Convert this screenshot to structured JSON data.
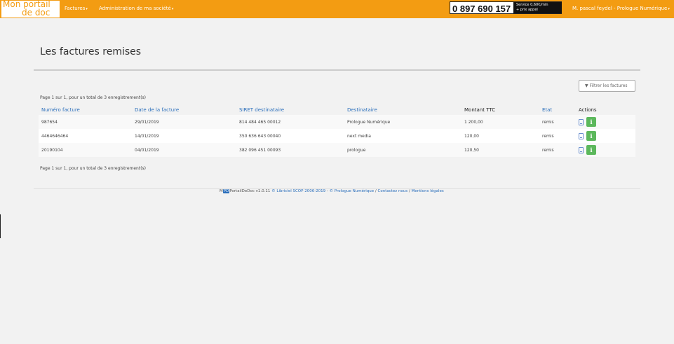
{
  "nav": {
    "logo_line1": "Mon portail",
    "logo_line2": "de doc",
    "menu_factures": "Factures",
    "menu_admin": "Administration de ma société",
    "phone_number": "0 897 690 157",
    "phone_service_line1": "Service 0,60€/min",
    "phone_service_line2": "+ prix appel",
    "user": "M. pascal feydel - Prologue Numérique",
    "caret": "▾"
  },
  "page": {
    "title": "Les factures remises",
    "filter_label": "Filtrer les factures",
    "filter_icon": "filter-icon",
    "page_info_top": "Page 1 sur 1, pour un total de 3 enregistrement(s)",
    "page_info_bottom": "Page 1 sur 1, pour un total de 3 enregistrement(s)"
  },
  "table": {
    "headers": [
      "Numéro facture",
      "Date de la facture",
      "SIRET destinataire",
      "Destinataire",
      "Montant TTC",
      "Etat",
      "Actions"
    ],
    "rows": [
      {
        "numero": "987654",
        "date": "29/01/2019",
        "siret": "814 484 465 00012",
        "destinataire": "Prologue Numérique",
        "montant": "1 200,00",
        "etat": "remis"
      },
      {
        "numero": "4464646464",
        "date": "14/01/2019",
        "siret": "350 636 643 00040",
        "destinataire": "next media",
        "montant": "120,00",
        "etat": "remis"
      },
      {
        "numero": "20190104",
        "date": "04/01/2019",
        "siret": "382 096 451 00093",
        "destinataire": "prologue",
        "montant": "120,50",
        "etat": "remis"
      }
    ],
    "info_glyph": "i"
  },
  "footer": {
    "m": "M",
    "badge": "PD",
    "app": "PortailDeDoc v1.0.11",
    "link1": "© Libriciel SCOP 2006-2019",
    "sep1": " - ",
    "link2": "© Prologue Numérique",
    "sep2": " / ",
    "link3": "Contactez nous",
    "sep3": " / ",
    "link4": "Mentions légales"
  },
  "colors": {
    "accent": "#f39c12",
    "link": "#2a6ebb",
    "success": "#5cb85c"
  }
}
